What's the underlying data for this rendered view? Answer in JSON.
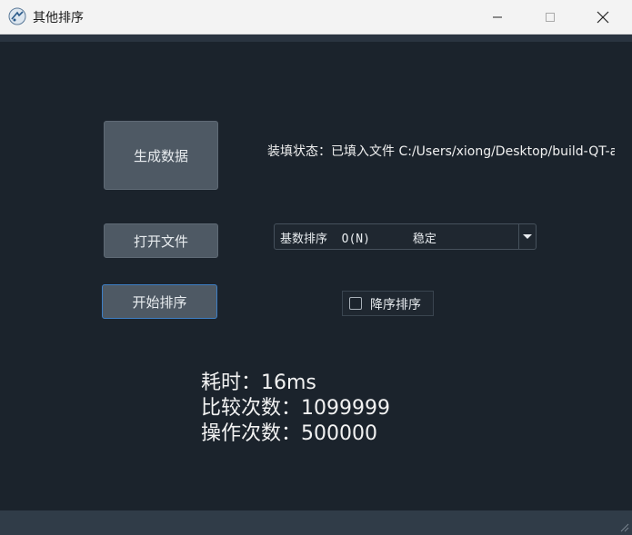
{
  "window": {
    "title": "其他排序",
    "icon": "app-icon"
  },
  "buttons": {
    "generate": "生成数据",
    "open_file": "打开文件",
    "start_sort": "开始排序"
  },
  "status": {
    "label": "装填状态：已填入文件 C:/Users/xiong/Desktop/build-QT-a"
  },
  "sort_select": {
    "selected": "基数排序  O(N)      稳定"
  },
  "descending": {
    "label": "降序排序",
    "checked": false
  },
  "results": {
    "time": "耗时：16ms",
    "compare": "比较次数：1099999",
    "operate": "操作次数：500000"
  },
  "colors": {
    "background": "#1b232c",
    "button": "#4e5964",
    "focus_border": "#3d7fc6",
    "titlebar": "#f3f3f3"
  }
}
